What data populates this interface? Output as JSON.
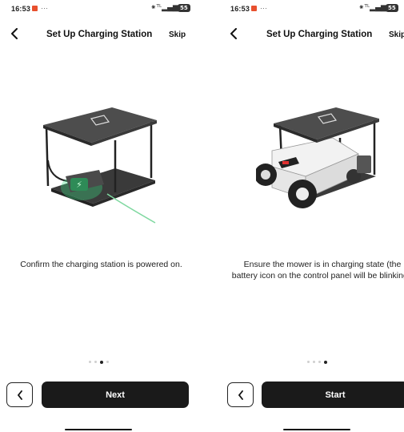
{
  "screens": [
    {
      "status": {
        "time": "16:53",
        "more": "···",
        "signal": "☀ᵀᴸ▂▄▆ ◠",
        "battery": "55"
      },
      "header": {
        "title": "Set Up Charging Station",
        "skip": "Skip"
      },
      "caption": "Confirm the charging station is powered on.",
      "pager": {
        "count": 4,
        "active": 2
      },
      "primary_label": "Next",
      "illustration": "charging-station-powered"
    },
    {
      "status": {
        "time": "16:53",
        "more": "···",
        "signal": "☀ᵀᴸ▂▄▆ ◠",
        "battery": "55"
      },
      "header": {
        "title": "Set Up Charging Station",
        "skip": "Skip"
      },
      "caption": "Ensure the mower is in charging state (the battery icon on the control panel will be blinking).",
      "pager": {
        "count": 4,
        "active": 3
      },
      "primary_label": "Start",
      "illustration": "mower-docked-charging"
    }
  ],
  "colors": {
    "accent_green": "#3ddc84",
    "primary_button": "#1a1a1a",
    "notification": "#e8502e"
  }
}
